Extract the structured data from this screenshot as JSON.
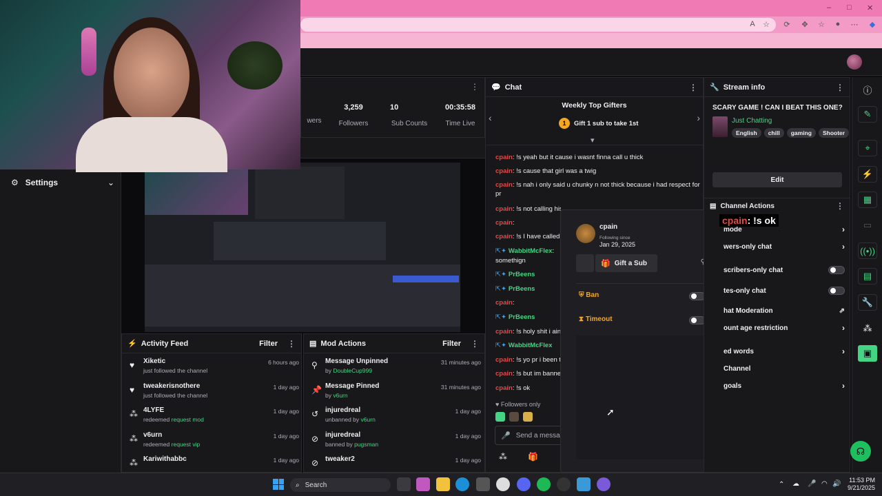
{
  "browser": {
    "controls": [
      "–",
      "□",
      "✕"
    ]
  },
  "stats": [
    {
      "value": "3,259",
      "label": "Followers"
    },
    {
      "value": "10",
      "label": "Sub Counts"
    },
    {
      "value": "00:35:58",
      "label": "Time Live"
    }
  ],
  "stats_partial_label": "wers",
  "settings": {
    "label": "Settings"
  },
  "chat": {
    "title": "Chat",
    "gifters_title": "Weekly Top Gifters",
    "gift_rank": "1",
    "gift_cta": "Gift 1 sub to take 1st",
    "lines": [
      {
        "user": "cpain",
        "text": ": !s yeah but it cause i wasnt finna call u thick"
      },
      {
        "user": "cpain",
        "text": ": !s cause that girl was a twig"
      },
      {
        "user": "cpain",
        "text": ": !s nah i only said u chunky n not thick because i had respect for pr"
      },
      {
        "user": "cpain",
        "text": ": !s not calling his"
      },
      {
        "user": "cpain",
        "text": ":"
      },
      {
        "user": "cpain",
        "text": ": !s I have called h"
      },
      {
        "user": "WabbitMcFlex",
        "text": ":",
        "green": true
      },
      {
        "user": "",
        "text": "somethign"
      },
      {
        "user": "PrBeens",
        "text": "",
        "green": true
      },
      {
        "user": "PrBeens",
        "text": "",
        "green": true
      },
      {
        "user": "cpain",
        "text": ":"
      },
      {
        "user": "PrBeens",
        "text": "",
        "green": true
      },
      {
        "user": "cpain",
        "text": ": !s holy shit i aint"
      },
      {
        "user": "WabbitMcFlex",
        "text": "",
        "green": true
      },
      {
        "user": "cpain",
        "text": ": !s yo pr i been tr"
      },
      {
        "user": "cpain",
        "text": ": !s but im bannec"
      },
      {
        "user": "cpain",
        "text": ": !s ok"
      }
    ],
    "followers_only": "Followers only",
    "input_placeholder": "Send a messa"
  },
  "usercard": {
    "username": "cpain",
    "following_label": "Following since",
    "following_date": "Jan 29, 2025",
    "gift_sub": "Gift a Sub",
    "ban": "Ban",
    "timeout": "Timeout"
  },
  "overlay_message": "cpain : !s ok",
  "overlay_user": "cpain",
  "overlay_text": ": !s ok",
  "stream_info": {
    "title": "Stream info",
    "stream_title": "SCARY GAME ! CAN I BEAT THIS ONE?",
    "category": "Just Chatting",
    "tags": [
      "English",
      "chill",
      "gaming",
      "Shooter"
    ],
    "edit": "Edit"
  },
  "channel_actions": {
    "title": "Channel Actions",
    "items": [
      {
        "label": "mode",
        "control": "chevron"
      },
      {
        "label": "wers-only chat",
        "control": "chevron"
      },
      {
        "label": "scribers-only chat",
        "control": "toggle"
      },
      {
        "label": "tes-only chat",
        "control": "toggle"
      },
      {
        "label": "hat Moderation",
        "control": "external"
      },
      {
        "label": "ount age restriction",
        "control": "chevron"
      },
      {
        "label": "ed words",
        "control": "chevron"
      },
      {
        "label": "Channel",
        "control": "none"
      },
      {
        "label": "goals",
        "control": "chevron"
      }
    ]
  },
  "activity_feed": {
    "title": "Activity Feed",
    "filter": "Filter",
    "rows": [
      {
        "name": "Xiketic",
        "action": "just followed the channel",
        "highlight": "",
        "time": "6 hours ago",
        "icon": "heart-icon"
      },
      {
        "name": "tweakerisnothere",
        "action": "just followed the channel",
        "highlight": "",
        "time": "1 day ago",
        "icon": "heart-icon"
      },
      {
        "name": "4LYFE",
        "action": "redeemed ",
        "highlight": "request mod",
        "time": "1 day ago",
        "icon": "points-icon"
      },
      {
        "name": "v6urn",
        "action": "redeemed ",
        "highlight": "request vip",
        "time": "1 day ago",
        "icon": "points-icon"
      },
      {
        "name": "Kariwithabbc",
        "action": "",
        "highlight": "",
        "time": "1 day ago",
        "icon": "points-icon"
      }
    ]
  },
  "mod_actions": {
    "title": "Mod Actions",
    "filter": "Filter",
    "rows": [
      {
        "name": "Message Unpinned",
        "action": "by ",
        "highlight": "DoubleCup999",
        "time": "31 minutes ago",
        "icon": "unpin-icon"
      },
      {
        "name": "Message Pinned",
        "action": "by ",
        "highlight": "v6urn",
        "time": "31 minutes ago",
        "icon": "pin-icon"
      },
      {
        "name": "injuredreal",
        "action": "unbanned by ",
        "highlight": "v6urn",
        "time": "1 day ago",
        "icon": "unban-icon"
      },
      {
        "name": "injuredreal",
        "action": "banned by ",
        "highlight": "pugsman",
        "time": "1 day ago",
        "icon": "ban-icon"
      },
      {
        "name": "tweaker2",
        "action": "",
        "highlight": "",
        "time": "1 day ago",
        "icon": "ban-icon"
      }
    ]
  },
  "taskbar": {
    "search": "Search",
    "time": "11:53 PM",
    "date": "9/21/2025"
  }
}
